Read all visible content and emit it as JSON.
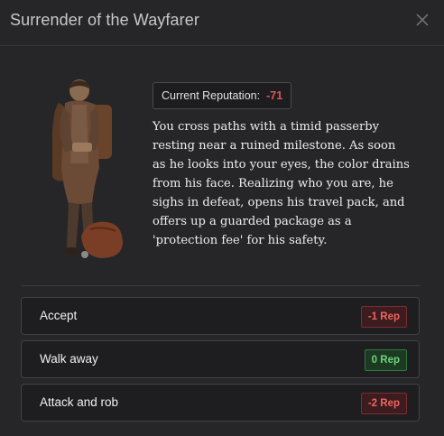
{
  "dialog": {
    "title": "Surrender of the Wayfarer",
    "close_icon": "close-icon"
  },
  "reputation": {
    "label": "Current Reputation:",
    "value": "-71",
    "value_color": "#e0554c"
  },
  "story": {
    "text": "You cross paths with a timid passerby resting near a ruined milestone. As soon as he looks into your eyes, the color drains from his face. Realizing who you are, he sighs in defeat, opens his travel pack, and offers up a guarded package as a 'protection fee' for his safety."
  },
  "options": [
    {
      "label": "Accept",
      "rep": "-1 Rep",
      "tone": "negative"
    },
    {
      "label": "Walk away",
      "rep": "0 Rep",
      "tone": "neutral"
    },
    {
      "label": "Attack and rob",
      "rep": "-2 Rep",
      "tone": "negative"
    }
  ],
  "colors": {
    "negative_badge": "#ee6560",
    "neutral_badge": "#6cd37c",
    "background": "#262629"
  }
}
